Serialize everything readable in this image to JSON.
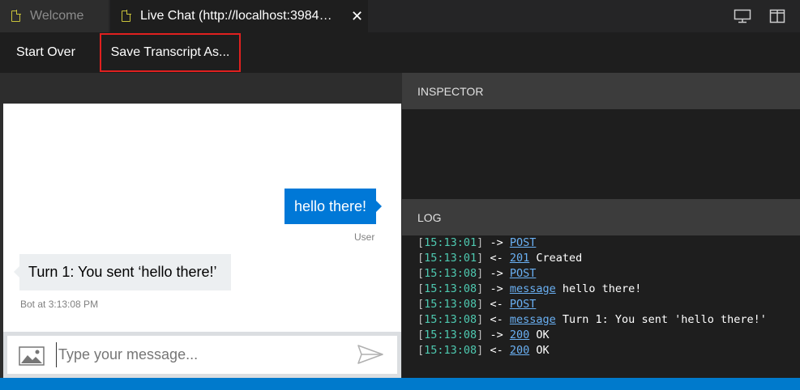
{
  "tabs": [
    {
      "label": "Welcome"
    },
    {
      "label": "Live Chat (http://localhost:3984…"
    }
  ],
  "toolbar": {
    "start_over_label": "Start Over",
    "save_transcript_label": "Save Transcript As..."
  },
  "chat": {
    "user_message": "hello there!",
    "user_label": "User",
    "bot_message": "Turn 1: You sent ‘hello there!’",
    "bot_label": "Bot at 3:13:08 PM",
    "input_placeholder": "Type your message...",
    "input_value": ""
  },
  "inspector": {
    "title": "INSPECTOR"
  },
  "log": {
    "title": "LOG",
    "entries": [
      {
        "time": "15:13:01",
        "dir": "->",
        "link": "POST",
        "text": ""
      },
      {
        "time": "15:13:01",
        "dir": "<-",
        "link": "201",
        "text": "Created"
      },
      {
        "time": "15:13:08",
        "dir": "->",
        "link": "POST",
        "text": ""
      },
      {
        "time": "15:13:08",
        "dir": "->",
        "link": "message",
        "text": "hello there!"
      },
      {
        "time": "15:13:08",
        "dir": "<-",
        "link": "POST",
        "text": ""
      },
      {
        "time": "15:13:08",
        "dir": "<-",
        "link": "message",
        "text": "Turn 1: You sent 'hello there!'"
      },
      {
        "time": "15:13:08",
        "dir": "->",
        "link": "200",
        "text": "OK"
      },
      {
        "time": "15:13:08",
        "dir": "<-",
        "link": "200",
        "text": "OK"
      }
    ]
  },
  "colors": {
    "accent": "#007acc",
    "user_bubble": "#0078d7",
    "highlight_border": "#e0201f",
    "timestamp": "#4ec9b0",
    "link": "#6ab0f3"
  },
  "icons": [
    "file-icon",
    "close-icon",
    "monitor-icon",
    "split-view-icon",
    "image-upload-icon",
    "send-icon"
  ]
}
